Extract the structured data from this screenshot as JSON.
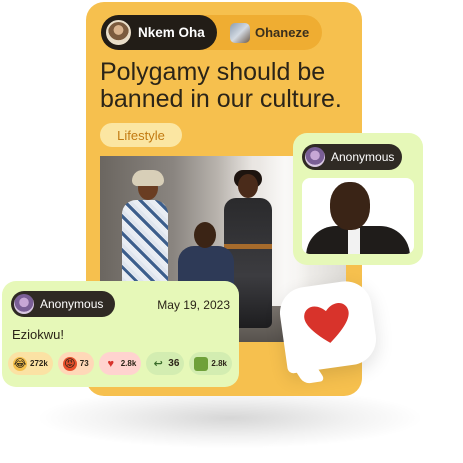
{
  "post": {
    "author_tab": {
      "name": "Nkem Oha",
      "avatar": "avatar-nkem-icon"
    },
    "group_tab": {
      "name": "Ohaneze",
      "avatar": "avatar-ohaneze-icon"
    },
    "title": "Polygamy should be banned in our culture.",
    "tag": "Lifestyle",
    "image": "photo-three-people"
  },
  "anon_reply_image": {
    "user": "Anonymous",
    "avatar": "avatar-anonymous-icon",
    "image": "photo-man-smiling"
  },
  "anon_comment": {
    "user": "Anonymous",
    "avatar": "avatar-anonymous-icon",
    "date": "May 19, 2023",
    "text": "Eziokwu!",
    "reactions": [
      {
        "icon": "laugh-emoji-icon",
        "count": "272k"
      },
      {
        "icon": "angry-emoji-icon",
        "count": "73"
      },
      {
        "icon": "heart-icon",
        "count": "2.8k"
      },
      {
        "icon": "reply-arrow-icon",
        "count": "36"
      },
      {
        "icon": "bag-icon",
        "count": "2.8k"
      }
    ]
  },
  "heart_bubble": {
    "icon": "heart-icon"
  },
  "colors": {
    "card": "#f6c04e",
    "comment_bg": "#e6f8b8",
    "pill": "#2f2a24",
    "tag_text": "#c27a11",
    "heart": "#d8332b"
  }
}
